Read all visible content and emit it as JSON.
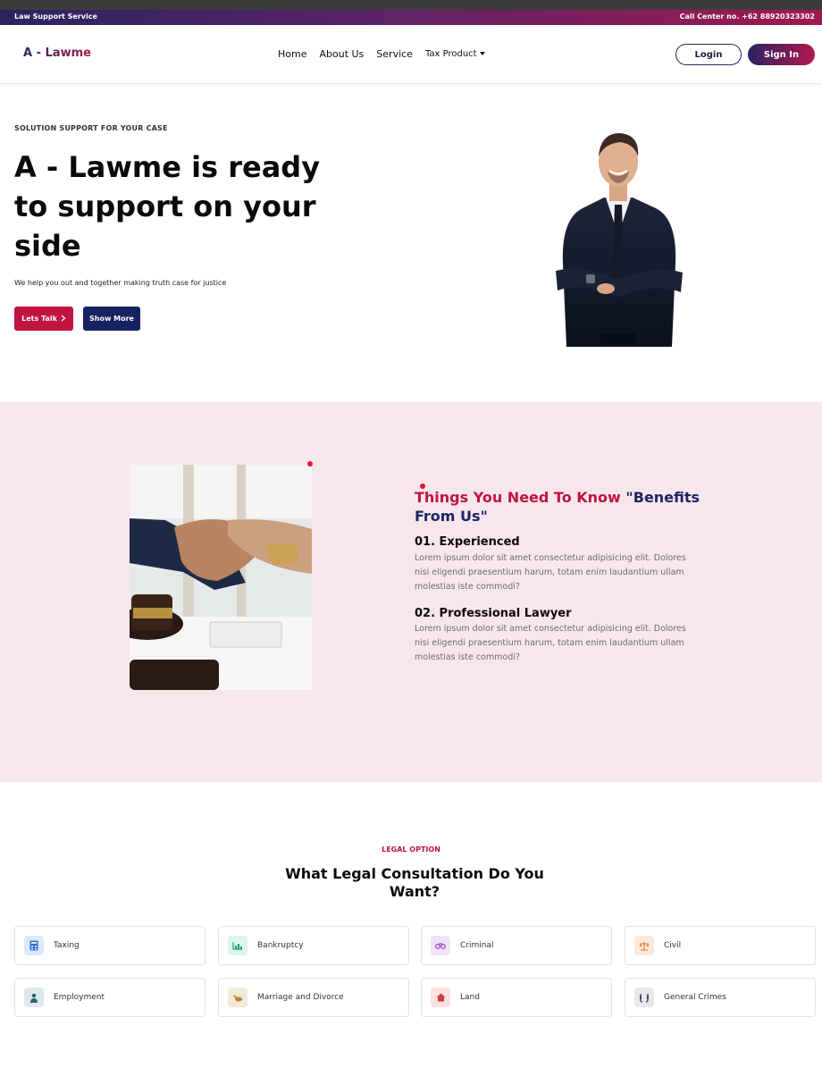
{
  "topbar": {
    "left": "Law Support Service",
    "right": "Call Center no. +62 88920323302"
  },
  "nav": {
    "logo": "A - Lawme",
    "links": [
      "Home",
      "About Us",
      "Service",
      "Tax Product"
    ],
    "login": "Login",
    "signin": "Sign In"
  },
  "hero": {
    "eyebrow": "SOLUTION SUPPORT FOR YOUR CASE",
    "title": "A - Lawme is ready to support on your side",
    "subtitle": "We help you out and together making truth case for justice",
    "btn_talk": "Lets Talk",
    "btn_more": "Show More"
  },
  "benefits": {
    "title_part1": "Things You Need To Know",
    "title_part2": "\"Benefits From Us\"",
    "items": [
      {
        "title": "01. Experienced",
        "body": "Lorem ipsum dolor sit amet consectetur adipisicing elit. Dolores nisi eligendi praesentium harum, totam enim laudantium ullam molestias iste commodi?"
      },
      {
        "title": "02. Professional Lawyer",
        "body": "Lorem ipsum dolor sit amet consectetur adipisicing elit. Dolores nisi eligendi praesentium harum, totam enim laudantium ullam molestias iste commodi?"
      }
    ]
  },
  "legal": {
    "eyebrow": "LEGAL OPTION",
    "title": "What Legal Consultation Do You Want?",
    "options": [
      {
        "label": "Taxing",
        "icon": "calculator-icon",
        "color": "#2f6fd6"
      },
      {
        "label": "Bankruptcy",
        "icon": "chart-icon",
        "color": "#1aa56a"
      },
      {
        "label": "Criminal",
        "icon": "handcuffs-icon",
        "color": "#8a3fc4"
      },
      {
        "label": "Civil",
        "icon": "scale-icon",
        "color": "#e07a2a"
      },
      {
        "label": "Employment",
        "icon": "worker-icon",
        "color": "#2a6470"
      },
      {
        "label": "Marriage and Divorce",
        "icon": "rings-icon",
        "color": "#b8862a"
      },
      {
        "label": "Land",
        "icon": "house-icon",
        "color": "#d03a3a"
      },
      {
        "label": "General Crimes",
        "icon": "shackles-icon",
        "color": "#444a52"
      }
    ]
  }
}
